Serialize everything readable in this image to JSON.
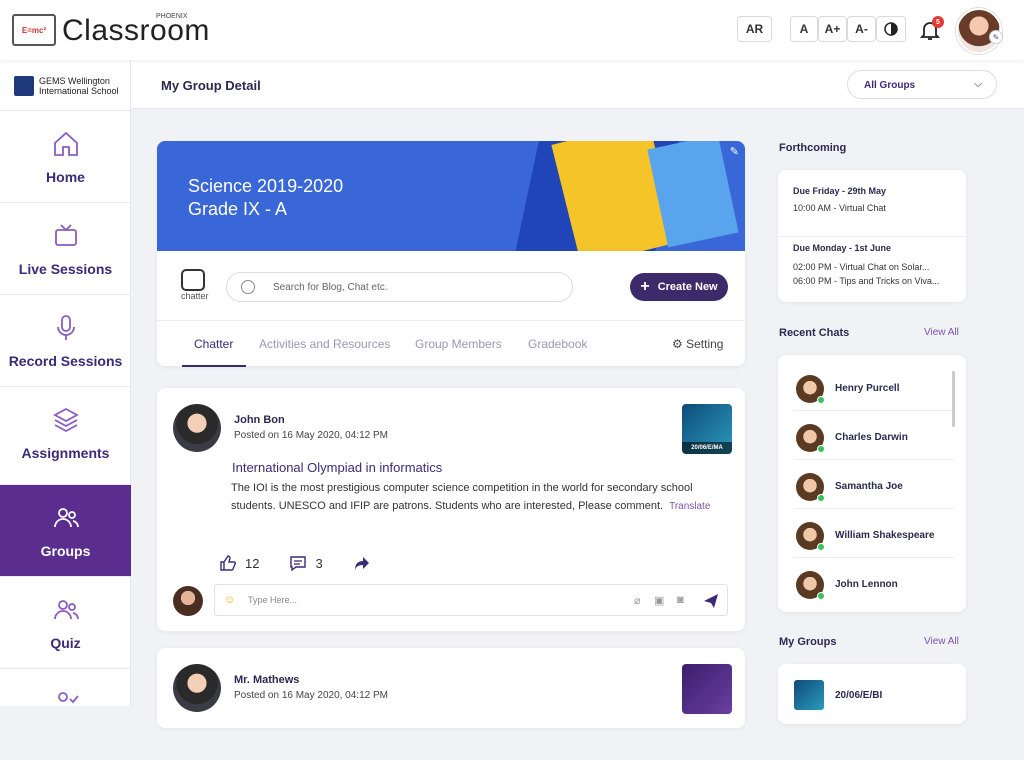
{
  "app": {
    "name": "Classroom",
    "badge": "PHOENIX"
  },
  "topbar": {
    "lang": "AR",
    "font_normal": "A",
    "font_plus": "A+",
    "font_minus": "A-",
    "notif_count": "5"
  },
  "school": {
    "name_line1": "GEMS Wellington",
    "name_line2": "International School"
  },
  "sidebar": {
    "items": [
      {
        "label": "Home"
      },
      {
        "label": "Live Sessions"
      },
      {
        "label": "Record Sessions"
      },
      {
        "label": "Assignments"
      },
      {
        "label": "Groups"
      },
      {
        "label": "Quiz"
      }
    ]
  },
  "page": {
    "title": "My Group Detail",
    "group_select": "All Groups"
  },
  "banner": {
    "line1": "Science 2019-2020",
    "line2": "Grade IX - A"
  },
  "toolbar": {
    "chatter_label": "chatter",
    "search_placeholder": "Search for Blog, Chat etc.",
    "create_label": "Create New"
  },
  "tabs": [
    {
      "label": "Chatter"
    },
    {
      "label": "Activities and Resources"
    },
    {
      "label": "Group Members"
    },
    {
      "label": "Gradebook"
    }
  ],
  "setting_label": "Setting",
  "posts": [
    {
      "author": "John Bon",
      "date": "Posted on 16 May 2020, 04:12 PM",
      "thumb_label": "20/06/E/MA",
      "title": "International Olympiad in informatics",
      "body": "The IOI is the most prestigious computer science competition in the world for secondary school students. UNESCO and IFIP are patrons. Students who are interested, Please comment.",
      "translate": "Translate",
      "likes": "12",
      "comments": "3",
      "reply_placeholder": "Type Here..."
    },
    {
      "author": "Mr. Mathews",
      "date": "Posted on 16 May 2020, 04:12 PM"
    }
  ],
  "forthcoming": {
    "title": "Forthcoming",
    "items": [
      {
        "due": "Due Friday - 29th May",
        "lines": [
          "10:00 AM - Virtual Chat"
        ]
      },
      {
        "due": "Due Monday - 1st June",
        "lines": [
          "02:00 PM - Virtual Chat on Solar...",
          "06:00 PM - Tips and Tricks on Viva..."
        ]
      }
    ]
  },
  "recent_chats": {
    "title": "Recent Chats",
    "view_all": "View All",
    "names": [
      "Henry Purcell",
      "Charles Darwin",
      "Samantha Joe",
      "William Shakespeare",
      "John Lennon"
    ]
  },
  "my_groups": {
    "title": "My Groups",
    "view_all": "View All",
    "items": [
      "20/06/E/BI"
    ]
  }
}
